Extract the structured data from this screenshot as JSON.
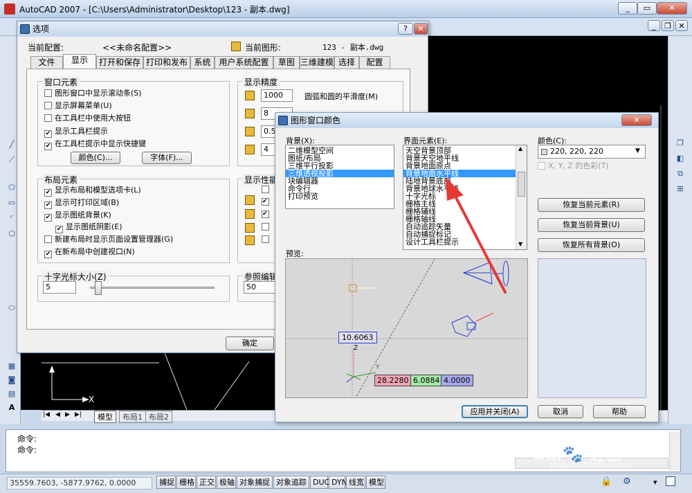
{
  "app": {
    "title": "AutoCAD 2007 - [C:\\Users\\Administrator\\Desktop\\123 - 副本.dwg]",
    "inner_min": "_",
    "inner_restore": "❐",
    "inner_close": "✕"
  },
  "options": {
    "title": "选项",
    "help": "?",
    "close": "✕",
    "profile_label": "当前配置:",
    "profile_value": "<<未命名配置>>",
    "drawing_label": "当前图形:",
    "drawing_value": "123 - 副本.dwg",
    "tabs": [
      "文件",
      "显示",
      "打开和保存",
      "打印和发布",
      "系统",
      "用户系统配置",
      "草图",
      "三维建模",
      "选择",
      "配置"
    ],
    "window_group": "窗口元素",
    "window_checks": [
      {
        "label": "图形窗口中显示滚动条(S)",
        "checked": false
      },
      {
        "label": "显示屏幕菜单(U)",
        "checked": false
      },
      {
        "label": "在工具栏中使用大按钮",
        "checked": false
      },
      {
        "label": "显示工具栏提示",
        "checked": true
      },
      {
        "label": "在工具栏提示中显示快捷键",
        "checked": true
      }
    ],
    "color_btn": "颜色(C)...",
    "font_btn": "字体(F)...",
    "layout_group": "布局元素",
    "layout_checks": [
      {
        "label": "显示布局和模型选项卡(L)",
        "checked": true
      },
      {
        "label": "显示可打印区域(B)",
        "checked": true
      },
      {
        "label": "显示图纸背景(K)",
        "checked": true
      },
      {
        "label": "显示图纸阴影(E)",
        "checked": true
      },
      {
        "label": "新建布局时显示页面设置管理器(G)",
        "checked": false
      },
      {
        "label": "在新布局中创建视口(N)",
        "checked": true
      }
    ],
    "cross_group": "十字光标大小(Z)",
    "cross_value": "5",
    "precision_group": "显示精度",
    "precision": [
      {
        "value": "1000",
        "label": "圆弧和圆的平滑度(M)"
      },
      {
        "value": "8",
        "label": ""
      },
      {
        "value": "0.5",
        "label": ""
      },
      {
        "value": "4",
        "label": ""
      }
    ],
    "perf_group": "显示性能",
    "ref_group": "参照编辑",
    "ref_value": "50",
    "ok": "确定"
  },
  "color_dialog": {
    "title": "图形窗口颜色",
    "close": "✕",
    "bg_label": "背景(X):",
    "bg_items": [
      "二维模型空间",
      "图纸/布局",
      "三维平行投影",
      "三维透视投影",
      "块编辑器",
      "命令行",
      "打印预览"
    ],
    "bg_selected": 3,
    "ui_label": "界面元素(E):",
    "ui_items": [
      "天空背景顶部",
      "背景天空地平线",
      "背景地面原点",
      "背景地面水平线",
      "陆地背景底部",
      "背景地球水平线",
      "十字光标",
      "栅格主线",
      "栅格辅线",
      "栅格轴线",
      "自动追踪矢量",
      "自动捕捉标记",
      "设计工具栏提示"
    ],
    "ui_selected": 3,
    "color_label": "颜色(C):",
    "color_value": "220, 220, 220",
    "xyz": "X, Y, Z 的色彩(T)",
    "restore_elem": "恢复当前元素(R)",
    "restore_bg": "恢复当前背景(U)",
    "restore_all": "恢复所有背景(O)",
    "preview_label": "预览:",
    "dim_z": "10.6063",
    "dim_x": "28.2280",
    "dim_y": "6.0884",
    "dim_c": "4.0000",
    "axis_z": "Z",
    "axis_y": "Y",
    "apply": "应用并关闭(A)",
    "cancel": "取消",
    "help": "帮助"
  },
  "drawing": {
    "axis_x": "X",
    "axis_y": "Y",
    "tabs": [
      "模型",
      "布局1",
      "布局2"
    ]
  },
  "command": {
    "line1": "命令:",
    "line2": "命令:"
  },
  "status": {
    "coords": "35559.7603, -5877.9762, 0.0000",
    "buttons": [
      "捕捉",
      "栅格",
      "正交",
      "极轴",
      "对象捕捉",
      "对象追踪",
      "DUCS",
      "DYN",
      "线宽",
      "模型"
    ]
  },
  "colors": {
    "accent": "#3399ff",
    "drawing_bg": "#000000",
    "arrow": "#e53935"
  }
}
